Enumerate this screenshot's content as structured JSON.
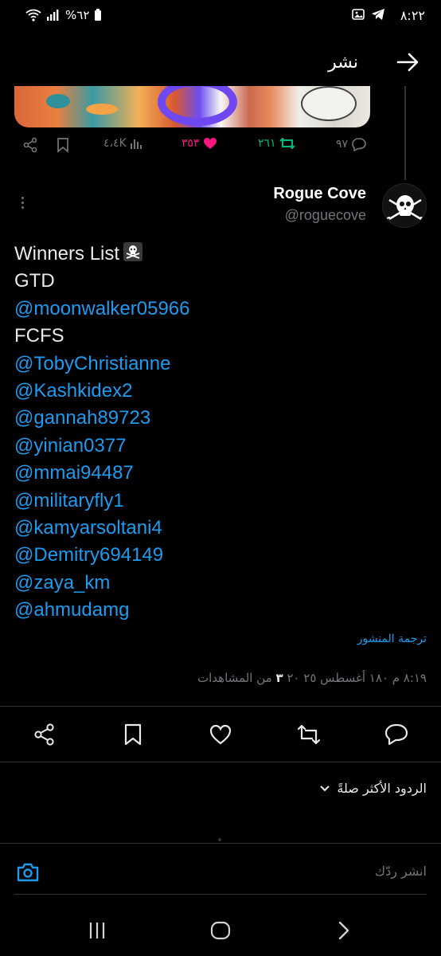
{
  "status_bar": {
    "time": "٨:٢٢",
    "battery": "%٦٢"
  },
  "header": {
    "title": "نشر"
  },
  "previous_post": {
    "replies": "٩٧",
    "reposts": "٢٦١",
    "likes": "٣٥٣",
    "views": "٤،٤K"
  },
  "post": {
    "author_name": "Rogue Cove",
    "author_handle": "@roguecove",
    "lines": [
      {
        "text": "Winners List",
        "kind": "text",
        "emoji": "pirate-flag"
      },
      {
        "text": "GTD",
        "kind": "text"
      },
      {
        "text": "@moonwalker05966",
        "kind": "mention"
      },
      {
        "text": "FCFS",
        "kind": "text"
      },
      {
        "text": "@TobyChristianne",
        "kind": "mention"
      },
      {
        "text": "@Kashkidex2",
        "kind": "mention"
      },
      {
        "text": "@gannah89723",
        "kind": "mention"
      },
      {
        "text": "@yinian0377",
        "kind": "mention"
      },
      {
        "text": "@mmai94487",
        "kind": "mention"
      },
      {
        "text": "@militaryfly1",
        "kind": "mention"
      },
      {
        "text": "@kamyarsoltani4",
        "kind": "mention"
      },
      {
        "text": "@Demitry694149",
        "kind": "mention"
      },
      {
        "text": "@zaya_km",
        "kind": "mention"
      },
      {
        "text": "@ahmudamg",
        "kind": "mention"
      }
    ],
    "translate_label": "ترجمة المنشور",
    "timestamp": "٨:١٩ م ١٨٠ أغسطس ٢٥ ٢٠",
    "views_count": "٣",
    "views_label": "من المشاهدات"
  },
  "replies": {
    "sort_label": "الردود الأكثر صلةً"
  },
  "composer": {
    "placeholder": "انشر ردّك"
  },
  "colors": {
    "accent": "#1d9bf0",
    "like": "#f91880",
    "repost": "#00ba7c",
    "muted": "#71767b",
    "background": "#000000"
  }
}
